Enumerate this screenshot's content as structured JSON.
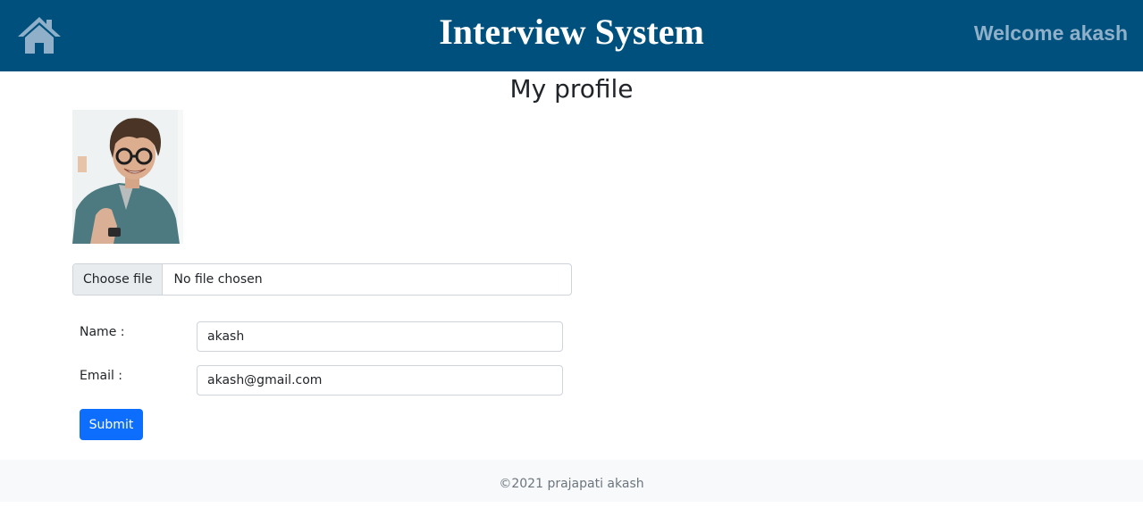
{
  "header": {
    "home_icon": "home-icon",
    "title": "Interview System",
    "welcome": "Welcome akash"
  },
  "page": {
    "title": "My profile",
    "avatar_icon": "profile-photo"
  },
  "file_upload": {
    "button_label": "Choose file",
    "status": "No file chosen"
  },
  "form": {
    "name_label": "Name :",
    "name_value": "akash",
    "email_label": "Email :",
    "email_value": "akash@gmail.com",
    "submit_label": "Submit"
  },
  "footer": {
    "text": "©2021 prajapati akash"
  },
  "colors": {
    "navbar": "#00507e",
    "primary_button": "#0d6efd",
    "welcome_text": "#8fb0c8"
  }
}
